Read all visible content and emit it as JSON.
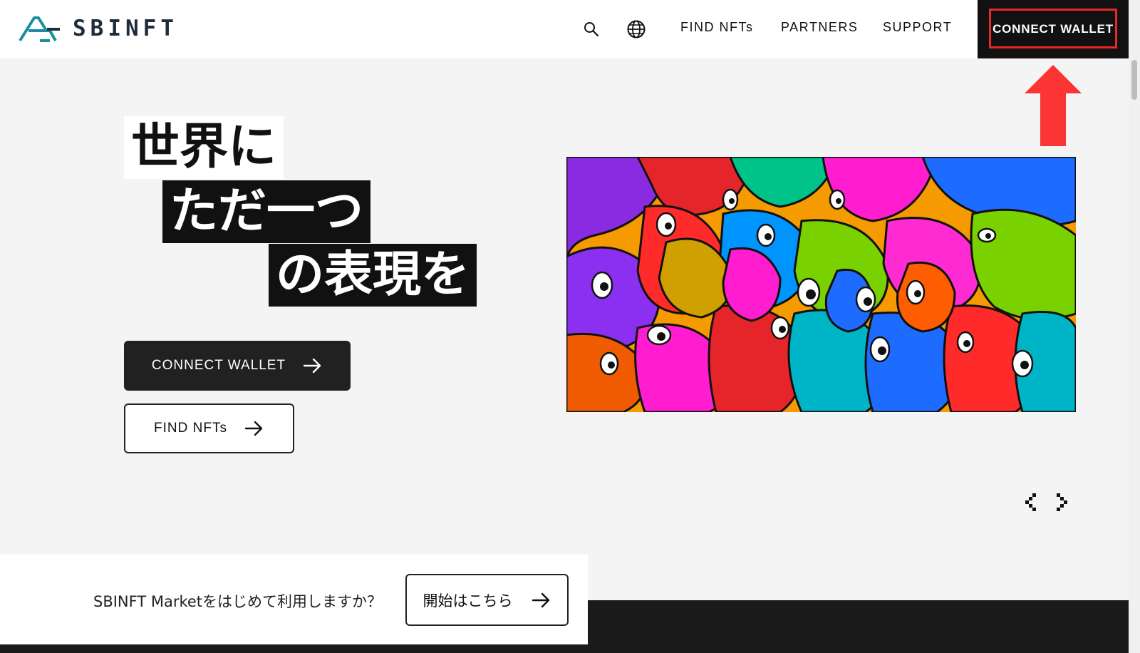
{
  "header": {
    "logo_text": "SBINFT",
    "nav": [
      "FIND NFTs",
      "PARTNERS",
      "SUPPORT"
    ],
    "connect_wallet": "CONNECT WALLET"
  },
  "hero": {
    "headline": [
      "世界に",
      "ただ一つ",
      "の表現を"
    ],
    "cta_primary": "CONNECT WALLET",
    "cta_secondary": "FIND NFTs"
  },
  "banner": {
    "text": "SBINFT Marketをはじめて利用しますか？",
    "button": "開始はこちら"
  },
  "colors": {
    "accent_red": "#e8272a",
    "dark": "#111111",
    "logo_teal": "#1a8ea0"
  }
}
